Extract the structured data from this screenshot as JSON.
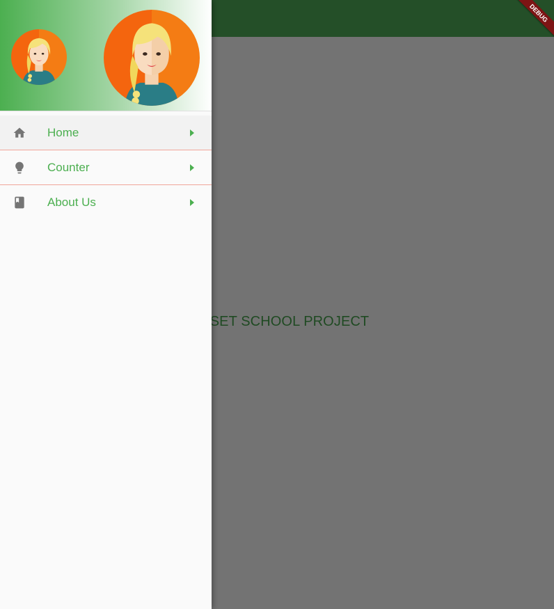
{
  "main": {
    "center_text": "SET SCHOOL PROJECT"
  },
  "debug_banner": {
    "label": "DEBUG"
  },
  "drawer": {
    "items": [
      {
        "label": "Home",
        "icon": "home-icon"
      },
      {
        "label": "Counter",
        "icon": "lightbulb-icon"
      },
      {
        "label": "About Us",
        "icon": "book-icon"
      }
    ]
  },
  "colors": {
    "app_bar": "#244f28",
    "scrim_body": "#737373",
    "menu_text": "#4caf50",
    "menu_icon": "#757575",
    "divider": "#f0a59a",
    "avatar_bg_left": "#f4650e",
    "avatar_bg_right": "#f47c14"
  }
}
